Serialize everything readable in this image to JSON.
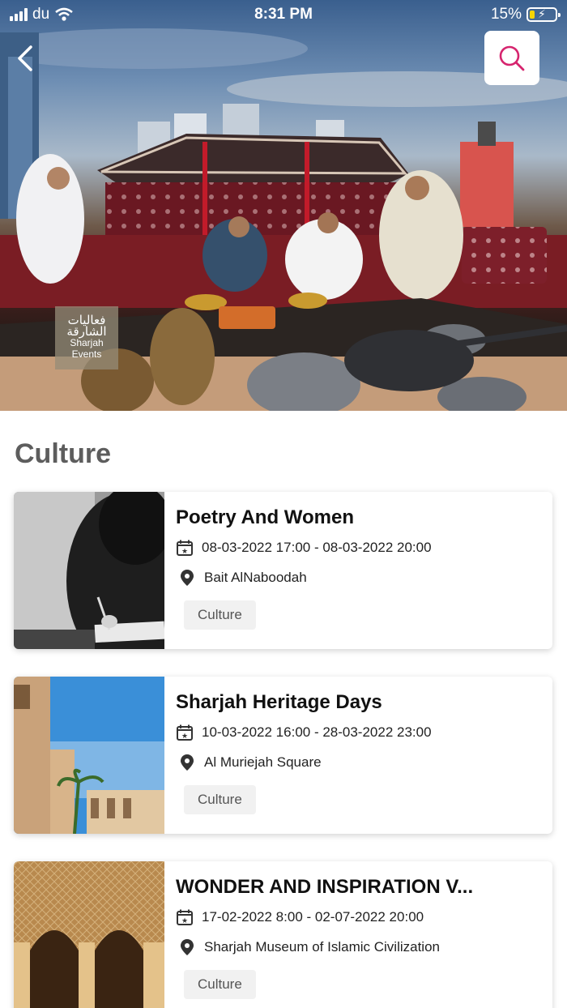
{
  "status_bar": {
    "carrier": "du",
    "time": "8:31 PM",
    "battery": "15%"
  },
  "hero": {
    "logo_arabic": "فعاليات الشارقة",
    "logo_english": "Sharjah Events"
  },
  "section": {
    "title": "Culture"
  },
  "events": [
    {
      "title": "Poetry And Women",
      "date": "08-03-2022 17:00 - 08-03-2022 20:00",
      "location": "Bait AlNaboodah",
      "tag": "Culture"
    },
    {
      "title": "Sharjah Heritage Days",
      "date": "10-03-2022 16:00 - 28-03-2022 23:00",
      "location": "Al Muriejah Square",
      "tag": "Culture"
    },
    {
      "title": "WONDER AND INSPIRATION V...",
      "date": "17-02-2022 8:00 - 02-07-2022 20:00",
      "location": "Sharjah Museum of Islamic Civilization",
      "tag": "Culture"
    }
  ],
  "colors": {
    "accent": "#d6246e",
    "title_grey": "#5d5d5d",
    "tag_bg": "#f1f1f1"
  },
  "icons": [
    "back-chevron-icon",
    "search-icon",
    "calendar-icon",
    "location-pin-icon",
    "wifi-icon",
    "signal-icon",
    "battery-icon"
  ]
}
